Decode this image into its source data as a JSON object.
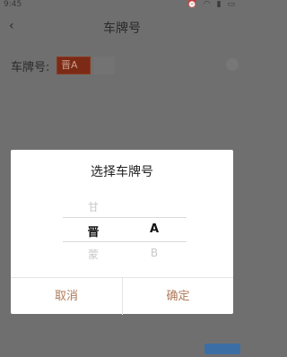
{
  "status_bar": {
    "time": "9:45",
    "icons": [
      "alarm-icon",
      "wifi-icon",
      "signal-icon",
      "battery-icon"
    ]
  },
  "header": {
    "back_icon": "back-arrow-icon",
    "title": "车牌号"
  },
  "plate_row": {
    "label": "车牌号:",
    "province_value": "晋A"
  },
  "dialog": {
    "title": "选择车牌号",
    "left_column": {
      "above": "甘",
      "selected": "晋",
      "below": "蒙"
    },
    "right_column": {
      "selected": "A",
      "below": "B"
    },
    "cancel_label": "取消",
    "confirm_label": "确定"
  }
}
